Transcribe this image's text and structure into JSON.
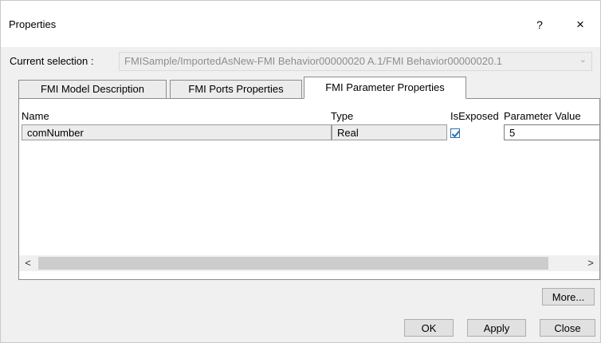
{
  "window": {
    "title": "Properties",
    "help_label": "?",
    "close_label": "×"
  },
  "selection": {
    "label": "Current selection :",
    "value": "FMISample/ImportedAsNew-FMI Behavior00000020 A.1/FMI Behavior00000020.1"
  },
  "tabs": [
    {
      "label": "FMI Model Description",
      "active": false
    },
    {
      "label": "FMI Ports Properties",
      "active": false
    },
    {
      "label": "FMI Parameter Properties",
      "active": true
    }
  ],
  "table": {
    "columns": [
      "Name",
      "Type",
      "IsExposed",
      "Parameter Value"
    ],
    "rows": [
      {
        "name": "comNumber",
        "type": "Real",
        "is_exposed": true,
        "value": "5"
      }
    ]
  },
  "scroll": {
    "left": "<",
    "right": ">"
  },
  "buttons": {
    "more": "More...",
    "ok": "OK",
    "apply": "Apply",
    "close": "Close"
  },
  "colors": {
    "dialog_bg": "#f0f0f0",
    "checkbox_accent": "#2d6fb3"
  }
}
